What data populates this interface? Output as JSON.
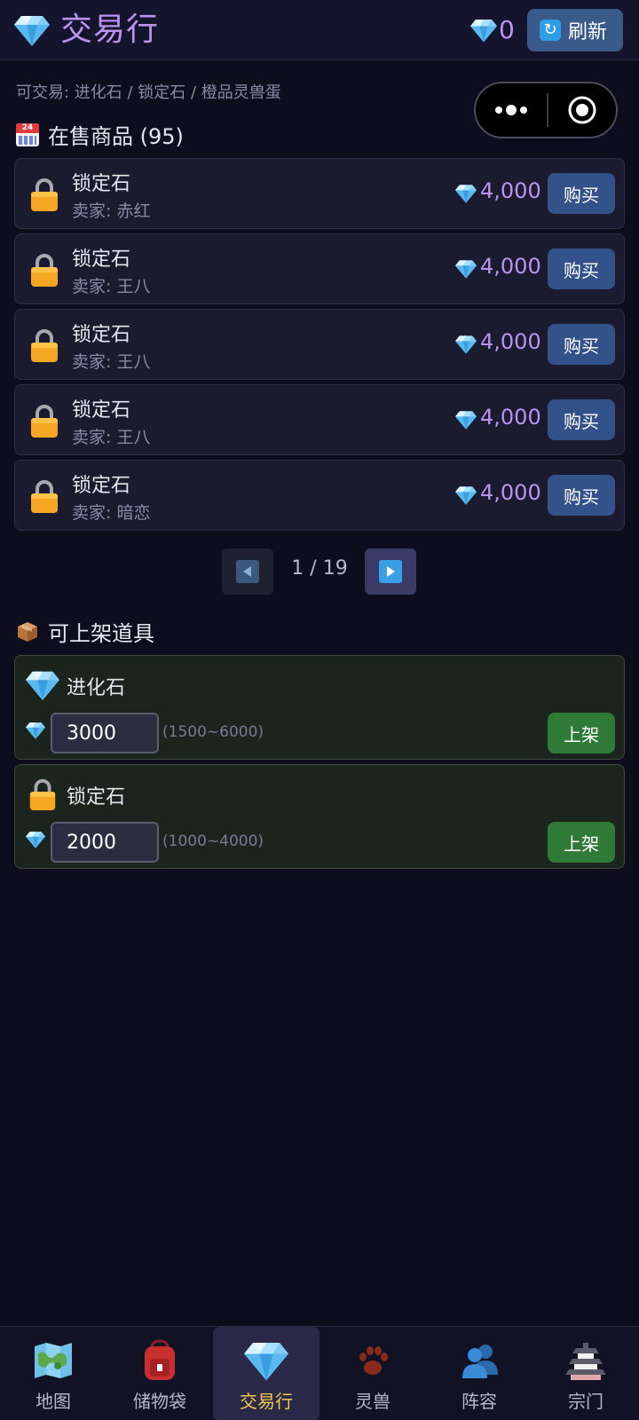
{
  "header": {
    "title": "交易行",
    "balance": "0",
    "refresh_label": "刷新"
  },
  "tradeable_info": "可交易: 进化石 / 锁定石 / 橙品灵兽蛋",
  "listings_section": {
    "title": "在售商品 (95)"
  },
  "listings": [
    {
      "name": "锁定石",
      "seller": "卖家: 赤红",
      "price": "4,000",
      "buy_label": "购买"
    },
    {
      "name": "锁定石",
      "seller": "卖家: 王八",
      "price": "4,000",
      "buy_label": "购买"
    },
    {
      "name": "锁定石",
      "seller": "卖家: 王八",
      "price": "4,000",
      "buy_label": "购买"
    },
    {
      "name": "锁定石",
      "seller": "卖家: 王八",
      "price": "4,000",
      "buy_label": "购买"
    },
    {
      "name": "锁定石",
      "seller": "卖家: 暗恋",
      "price": "4,000",
      "buy_label": "购买"
    }
  ],
  "pagination": {
    "indicator": "1 / 19"
  },
  "sellable_section": {
    "title": "可上架道具"
  },
  "sellable": [
    {
      "name": "进化石",
      "icon": "diamond-icon",
      "value": "3000",
      "range": "(1500~6000)",
      "list_label": "上架"
    },
    {
      "name": "锁定石",
      "icon": "lock-icon",
      "value": "2000",
      "range": "(1000~4000)",
      "list_label": "上架"
    }
  ],
  "bottom_nav": [
    {
      "label": "地图",
      "icon": "map-icon"
    },
    {
      "label": "储物袋",
      "icon": "backpack-icon"
    },
    {
      "label": "交易行",
      "icon": "diamond-icon",
      "active": true
    },
    {
      "label": "灵兽",
      "icon": "paw-icon"
    },
    {
      "label": "阵容",
      "icon": "people-icon"
    },
    {
      "label": "宗门",
      "icon": "castle-icon"
    }
  ],
  "colors": {
    "accent": "#b894f0",
    "buy_button": "#34528a",
    "list_button": "#2f7a36",
    "active_nav": "#f2c94c"
  }
}
